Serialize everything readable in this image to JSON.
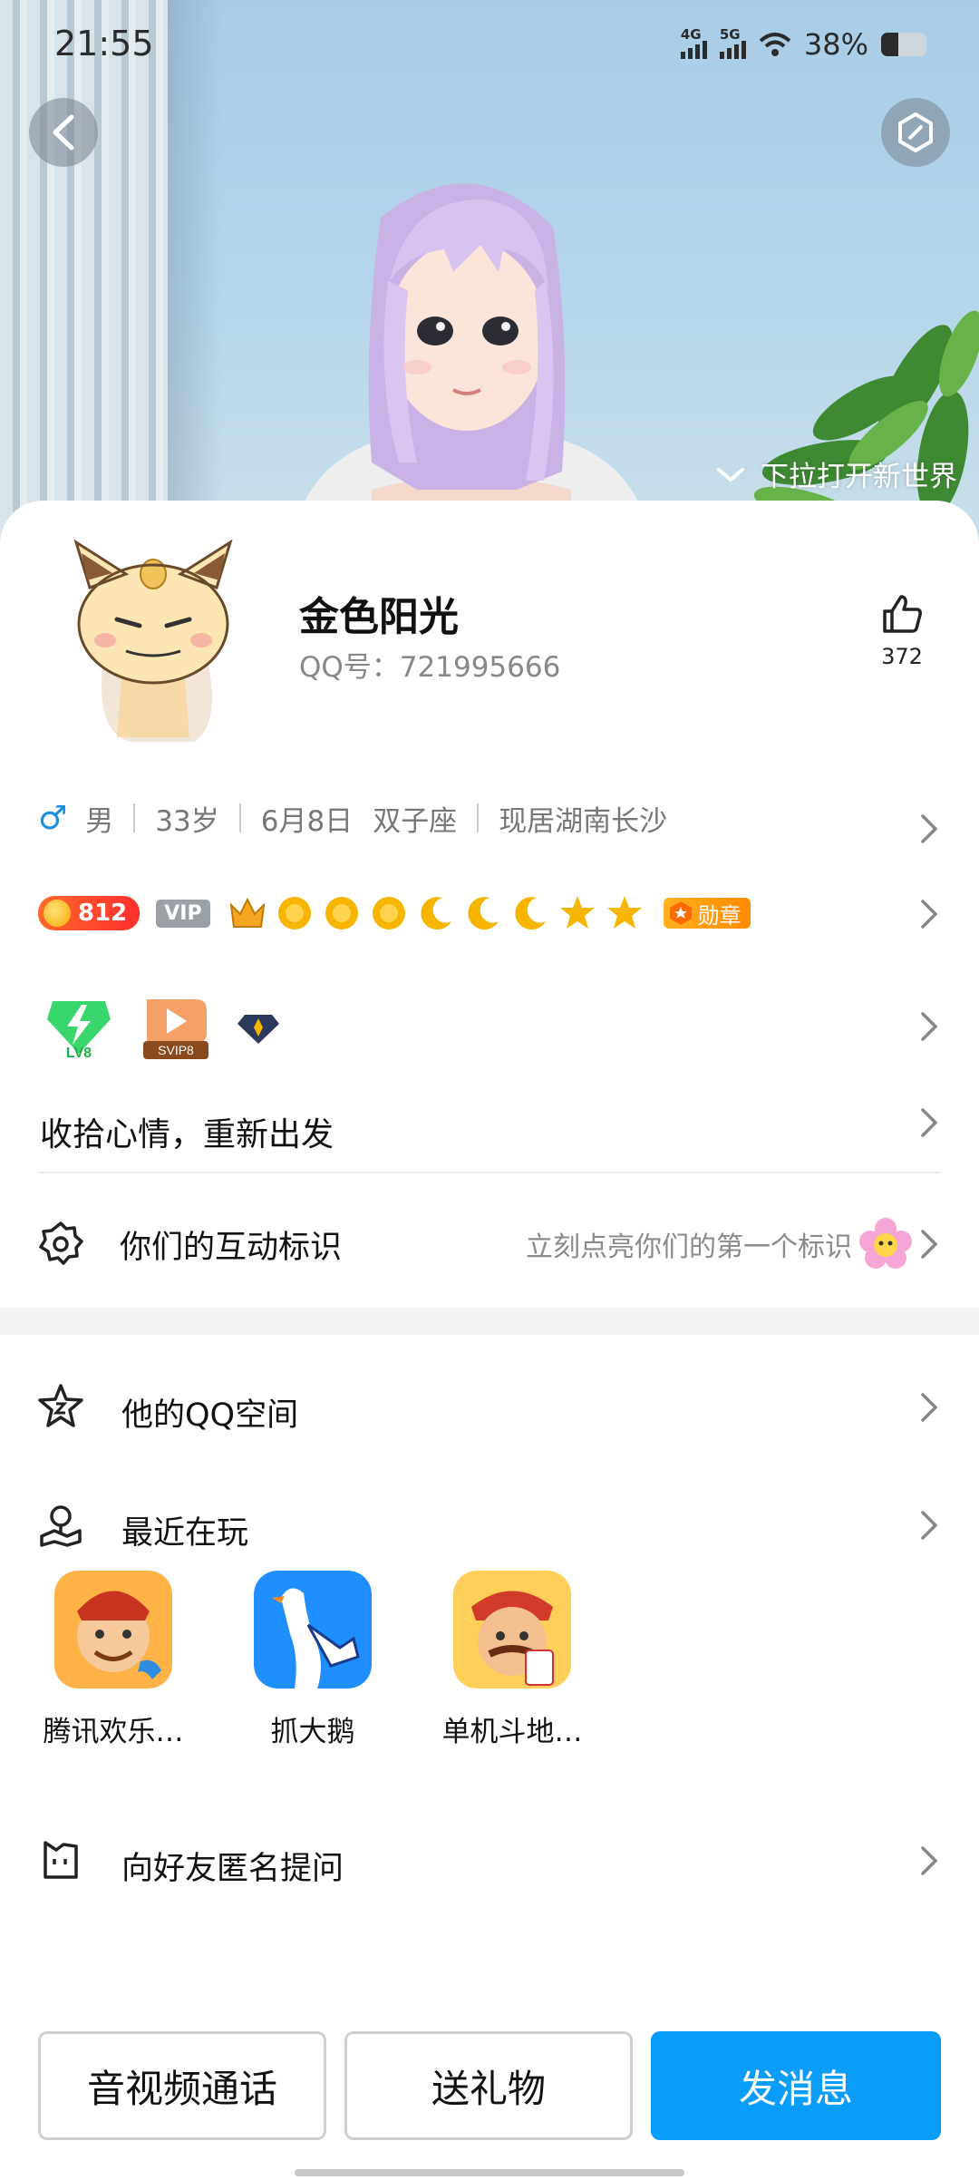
{
  "status_bar": {
    "time": "21:55",
    "net1": "4G",
    "net2": "5G",
    "battery_percent": "38%",
    "battery_level": 0.38
  },
  "hero": {
    "pull_hint": "下拉打开新世界"
  },
  "profile": {
    "nickname": "金色阳光",
    "qq_label": "QQ号：721995666",
    "likes": "372"
  },
  "info": {
    "gender": "男",
    "age": "33岁",
    "birthday": "6月8日",
    "zodiac": "双子座",
    "location": "现居湖南长沙"
  },
  "level": {
    "points": "812",
    "vip_label": "VIP",
    "medal_label": "勋章"
  },
  "vip_badges": {
    "lv": "LV8",
    "svip": "SVIP8"
  },
  "signature": "收拾心情，重新出发",
  "interaction": {
    "title": "你们的互动标识",
    "hint": "立刻点亮你们的第一个标识"
  },
  "sections": {
    "qzone": "他的QQ空间",
    "recent_play": "最近在玩",
    "ask": "向好友匿名提问"
  },
  "games": [
    {
      "name": "腾讯欢乐…"
    },
    {
      "name": "抓大鹅"
    },
    {
      "name": "单机斗地…"
    }
  ],
  "actions": {
    "call": "音视频通话",
    "gift": "送礼物",
    "message": "发消息"
  },
  "colors": {
    "primary": "#0a9cf9",
    "male_blue": "#1a8fe0"
  }
}
